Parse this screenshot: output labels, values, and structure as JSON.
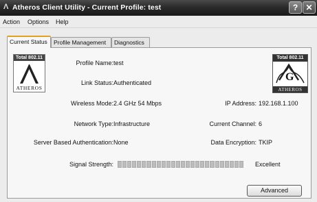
{
  "window": {
    "title": "Atheros Client Utility - Current Profile: test",
    "icon": "atheros-lambda-icon",
    "help_glyph": "?",
    "close_glyph": "✕"
  },
  "menu": [
    "Action",
    "Options",
    "Help"
  ],
  "tabs": [
    {
      "label": "Current Status",
      "active": true
    },
    {
      "label": "Profile Management",
      "active": false
    },
    {
      "label": "Diagnostics",
      "active": false
    }
  ],
  "logos": {
    "left_band": "Total 802.11",
    "left_word": "ATHEROS",
    "right_band": "Total 802.11",
    "right_letter": "G",
    "right_word": "ATHEROS"
  },
  "status": {
    "profile_name_label": "Profile Name:",
    "profile_name_value": "test",
    "link_status_label": "Link Status:",
    "link_status_value": "Authenticated",
    "wireless_mode_label": "Wireless Mode:",
    "wireless_mode_value": "2.4 GHz 54 Mbps",
    "ip_address_label": "IP Address:",
    "ip_address_value": "192.168.1.100",
    "network_type_label": "Network Type:",
    "network_type_value": "Infrastructure",
    "current_channel_label": "Current Channel:",
    "current_channel_value": "6",
    "server_auth_label": "Server Based Authentication:",
    "server_auth_value": "None",
    "data_encryption_label": "Data Encryption:",
    "data_encryption_value": "TKIP",
    "signal_strength_label": "Signal Strength:",
    "signal_strength_value": "Excellent",
    "signal_fraction": 1.0
  },
  "buttons": {
    "advanced_label": "Advanced"
  },
  "colors": {
    "active_tab_accent": "#e0a020",
    "titlebar": "#2b2b2b"
  }
}
